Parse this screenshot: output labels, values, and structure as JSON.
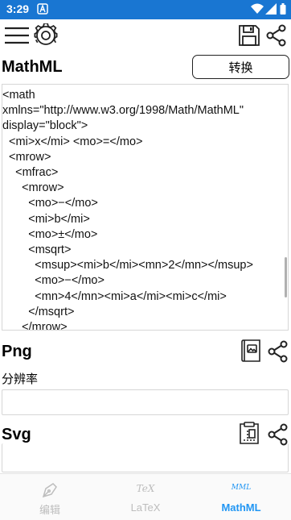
{
  "status_bar": {
    "time": "3:29",
    "notification_icon": "a-app-icon",
    "wifi_icon": "wifi-icon",
    "signal_icon": "signal-icon",
    "battery_icon": "battery-icon"
  },
  "toolbar": {
    "menu_icon": "menu-icon",
    "settings_icon": "gear-icon",
    "save_icon": "save-icon",
    "share_icon": "share-icon"
  },
  "mathml_section": {
    "title": "MathML",
    "convert_label": "转换",
    "code": "<math\nxmlns=\"http://www.w3.org/1998/Math/MathML\"\ndisplay=\"block\">\n  <mi>x</mi> <mo>=</mo>\n  <mrow>\n    <mfrac>\n      <mrow>\n        <mo>−</mo>\n        <mi>b</mi>\n        <mo>±</mo>\n        <msqrt>\n          <msup><mi>b</mi><mn>2</mn></msup>\n          <mo>−</mo>\n          <mn>4</mn><mi>a</mi><mi>c</mi>\n        </msqrt>\n      </mrow>"
  },
  "png_section": {
    "title": "Png",
    "resolution_label": "分辨率",
    "resolution_value": "",
    "preview_icon": "image-preview-icon",
    "share_icon": "share-icon"
  },
  "svg_section": {
    "title": "Svg",
    "preview_icon": "clipboard-icon",
    "share_icon": "share-icon"
  },
  "bottom_nav": {
    "items": [
      {
        "label": "编辑",
        "icon": "pen-nib-icon",
        "active": false
      },
      {
        "label": "LaTeX",
        "icon": "tex-icon",
        "icon_text": "TeX",
        "active": false
      },
      {
        "label": "MathML",
        "icon": "mml-icon",
        "icon_text": "MML",
        "active": true
      }
    ]
  },
  "colors": {
    "status_bar": "#1976d2",
    "accent": "#2196f3",
    "inactive": "#bdbdbd"
  }
}
